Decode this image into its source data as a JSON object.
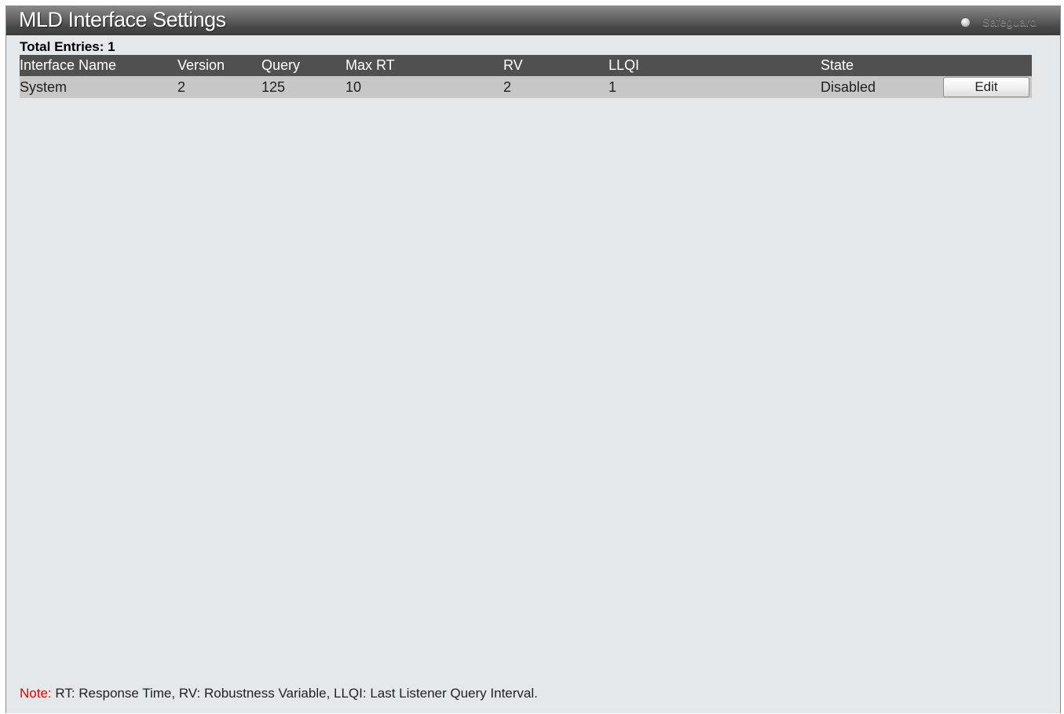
{
  "page": {
    "title": "MLD Interface Settings",
    "safeguard_label": "Safeguard"
  },
  "summary": {
    "total_entries": "Total Entries: 1"
  },
  "table": {
    "columns": [
      "Interface Name",
      "Version",
      "Query",
      "Max RT",
      "RV",
      "LLQI",
      "State"
    ],
    "rows": [
      {
        "interface_name": "System",
        "version": "2",
        "query": "125",
        "max_rt": "10",
        "rv": "2",
        "llqi": "1",
        "state": "Disabled",
        "action_label": "Edit"
      }
    ]
  },
  "note": {
    "label": "Note:",
    "text": " RT: Response Time, RV: Robustness Variable, LLQI: Last Listener Query Interval."
  },
  "colors": {
    "title_bar": "#4a4a4a",
    "header_row": "#505050",
    "data_row": "#c7c7c7",
    "background": "#e4e8eb",
    "note_label": "#e60000"
  },
  "icons": {
    "safeguard": "safeguard-status-icon"
  }
}
